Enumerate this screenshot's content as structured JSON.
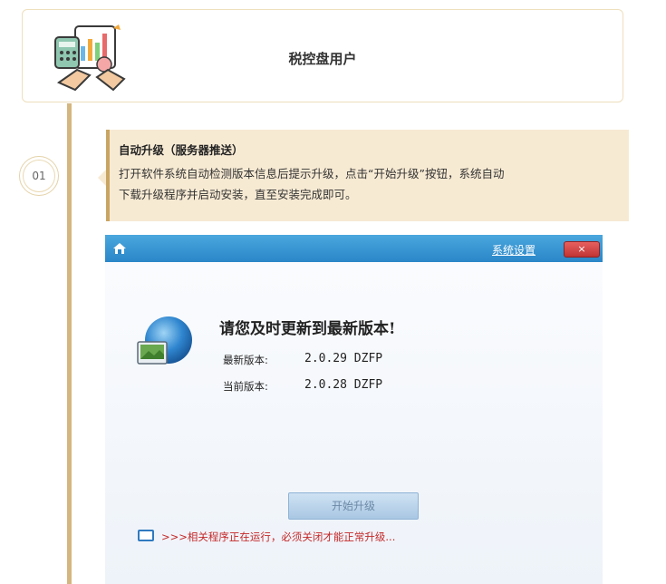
{
  "header": {
    "title": "税控盘用户"
  },
  "step": {
    "number": "01",
    "note_title": "自动升级（服务器推送）",
    "note_line1": "打开软件系统自动检测版本信息后提示升级，点击“开始升级”按钮，系统自动",
    "note_line2": "下载升级程序并启动安装，直至安装完成即可。"
  },
  "app": {
    "settings_link": "系统设置",
    "close_label": "×",
    "headline": "请您及时更新到最新版本!",
    "latest_label": "最新版本:",
    "latest_value": "2.0.29  DZFP",
    "current_label": "当前版本:",
    "current_value": "2.0.28  DZFP",
    "start_button": "开始升级",
    "warning": ">>>相关程序正在运行，必须关闭才能正常升级..."
  },
  "colors": {
    "accent_gold": "#d4b780",
    "note_bg": "#f7ead3",
    "titlebar_blue": "#2a86c8",
    "warning_red": "#c42828"
  }
}
